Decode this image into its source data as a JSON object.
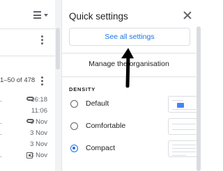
{
  "list": {
    "pagination": "1–50 of 478",
    "rows": [
      {
        "date": "16:18",
        "icon": "attachment-icon",
        "prefix": "."
      },
      {
        "date": "11:06",
        "icon": "",
        "prefix": ""
      },
      {
        "date": "3 Nov",
        "icon": "attachment-icon",
        "prefix": "."
      },
      {
        "date": "3 Nov",
        "icon": "",
        "prefix": "."
      },
      {
        "date": "3 Nov",
        "icon": "",
        "prefix": ""
      },
      {
        "date": "3 Nov",
        "icon": "calendar-icon",
        "prefix": "."
      }
    ]
  },
  "quick_settings": {
    "title": "Quick settings",
    "see_all_label": "See all settings",
    "manage_label": "Manage the organisation",
    "density": {
      "label": "DENSITY",
      "options": [
        {
          "label": "Default",
          "selected": false
        },
        {
          "label": "Comfortable",
          "selected": false
        },
        {
          "label": "Compact",
          "selected": true
        }
      ]
    }
  },
  "colors": {
    "accent": "#1a73e8",
    "annotation_arrow": "#000000"
  }
}
